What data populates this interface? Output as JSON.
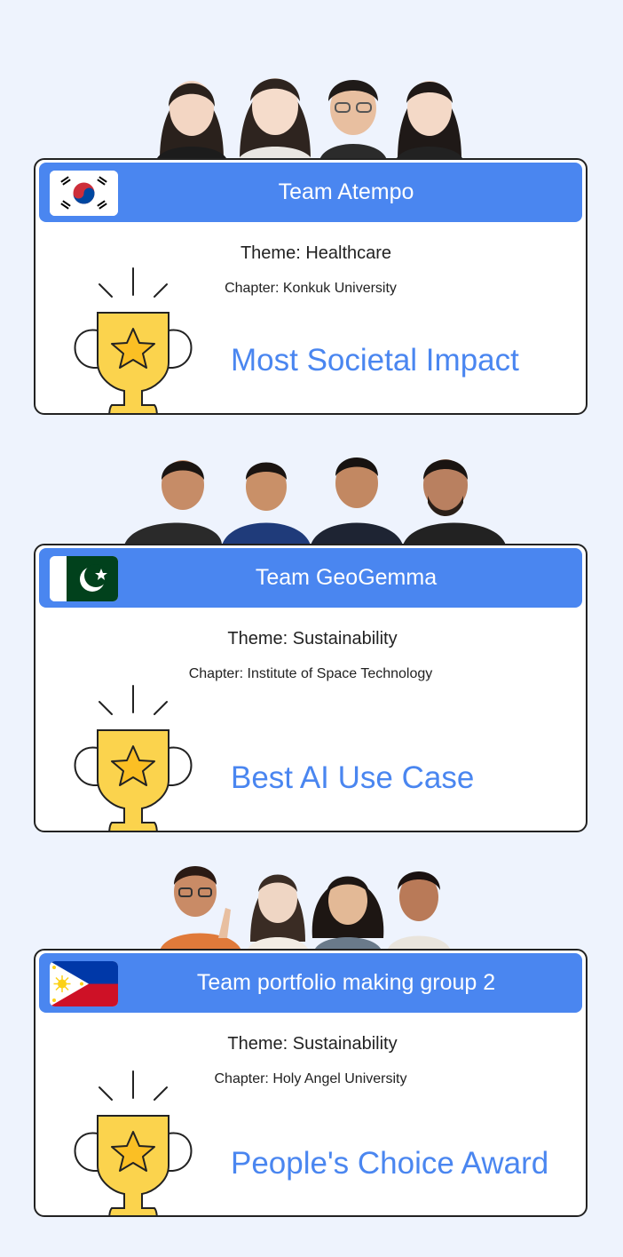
{
  "teams": [
    {
      "team_name": "Team Atempo",
      "flag_icon": "south-korea-flag-icon",
      "theme": "Theme: Healthcare",
      "chapter": "Chapter: Konkuk University",
      "award": "Most Societal Impact"
    },
    {
      "team_name": "Team GeoGemma",
      "flag_icon": "pakistan-flag-icon",
      "theme": "Theme: Sustainability",
      "chapter": "Chapter: Institute of Space Technology",
      "award": "Best AI Use Case"
    },
    {
      "team_name": "Team portfolio making group 2",
      "flag_icon": "philippines-flag-icon",
      "theme": "Theme: Sustainability",
      "chapter": "Chapter: Holy Angel University",
      "award": "People's Choice Award"
    }
  ],
  "colors": {
    "background": "#eef3fd",
    "banner": "#4a86f0",
    "award_text": "#4a86f0",
    "trophy": "#fbd34d"
  }
}
